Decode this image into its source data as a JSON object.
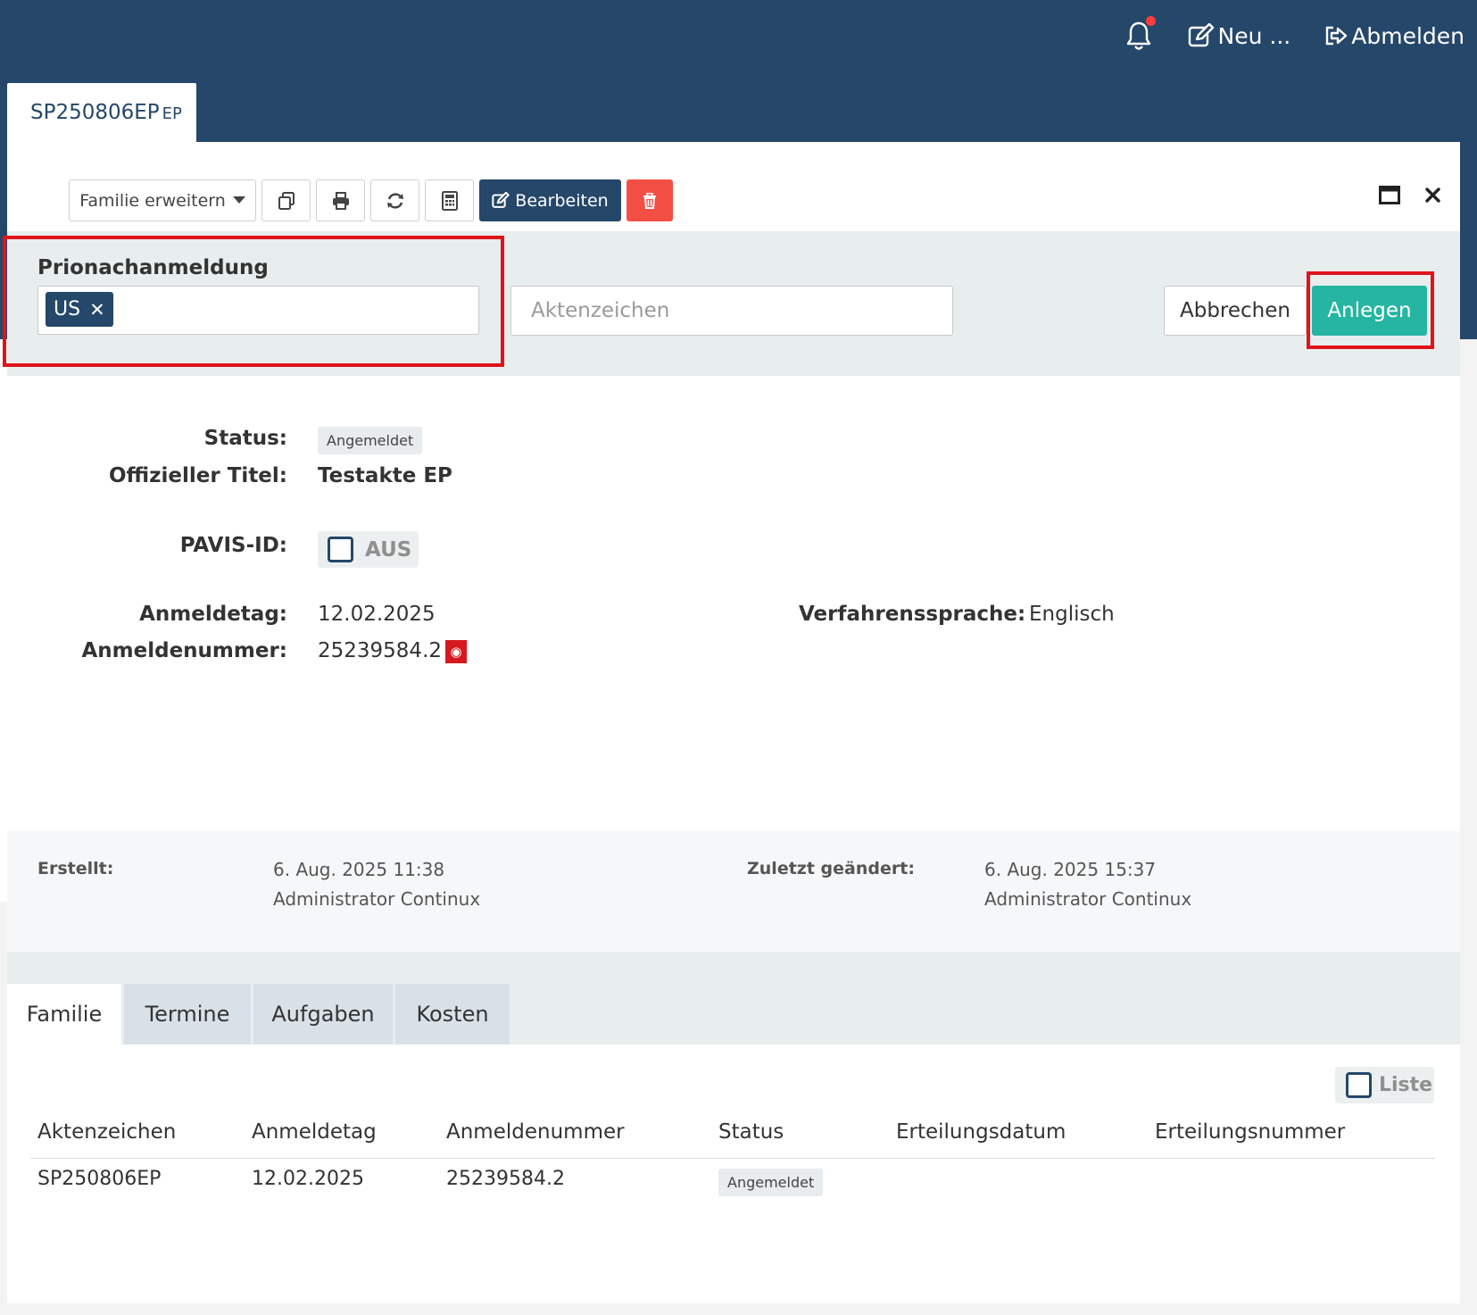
{
  "header": {
    "neu_label": "Neu ...",
    "abmelden_label": "Abmelden",
    "notification_dot_color": "#ff3b3b"
  },
  "document_tab": {
    "title": "SP250806EP",
    "suffix": "EP"
  },
  "toolbar": {
    "familie_label": "Familie erweitern",
    "bearbeiten_label": "Bearbeiten"
  },
  "prio": {
    "label": "Prionachanmeldung",
    "tag": "US",
    "aktenzeichen_placeholder": "Aktenzeichen",
    "abbrechen_label": "Abbrechen",
    "anlegen_label": "Anlegen"
  },
  "details": {
    "status_label": "Status:",
    "status_value": "Angemeldet",
    "titel_label": "Offizieller Titel:",
    "titel_value": "Testakte EP",
    "pavis_label": "PAVIS-ID:",
    "pavis_toggle": "AUS",
    "anmeldetag_label": "Anmeldetag:",
    "anmeldetag_value": "12.02.2025",
    "anmeldenummer_label": "Anmeldenummer:",
    "anmeldenummer_value": "25239584.2",
    "sprache_label": "Verfahrenssprache:",
    "sprache_value": "Englisch"
  },
  "meta": {
    "erstellt_label": "Erstellt:",
    "erstellt_date": "6. Aug. 2025 11:38",
    "erstellt_user": "Administrator Continux",
    "geaendert_label": "Zuletzt geändert:",
    "geaendert_date": "6. Aug. 2025 15:37",
    "geaendert_user": "Administrator Continux"
  },
  "tabs": [
    "Familie",
    "Termine",
    "Aufgaben",
    "Kosten"
  ],
  "family_table": {
    "liste_label": "Liste",
    "columns": [
      "Aktenzeichen",
      "Anmeldetag",
      "Anmeldenummer",
      "Status",
      "Erteilungsdatum",
      "Erteilungsnummer"
    ],
    "rows": [
      [
        "SP250806EP",
        "12.02.2025",
        "25239584.2",
        "Angemeldet",
        "",
        ""
      ]
    ]
  },
  "colors": {
    "brand": "#25476a",
    "anlegen": "#26b5a2",
    "danger": "#f44f44",
    "highlight": "#e0131b"
  }
}
